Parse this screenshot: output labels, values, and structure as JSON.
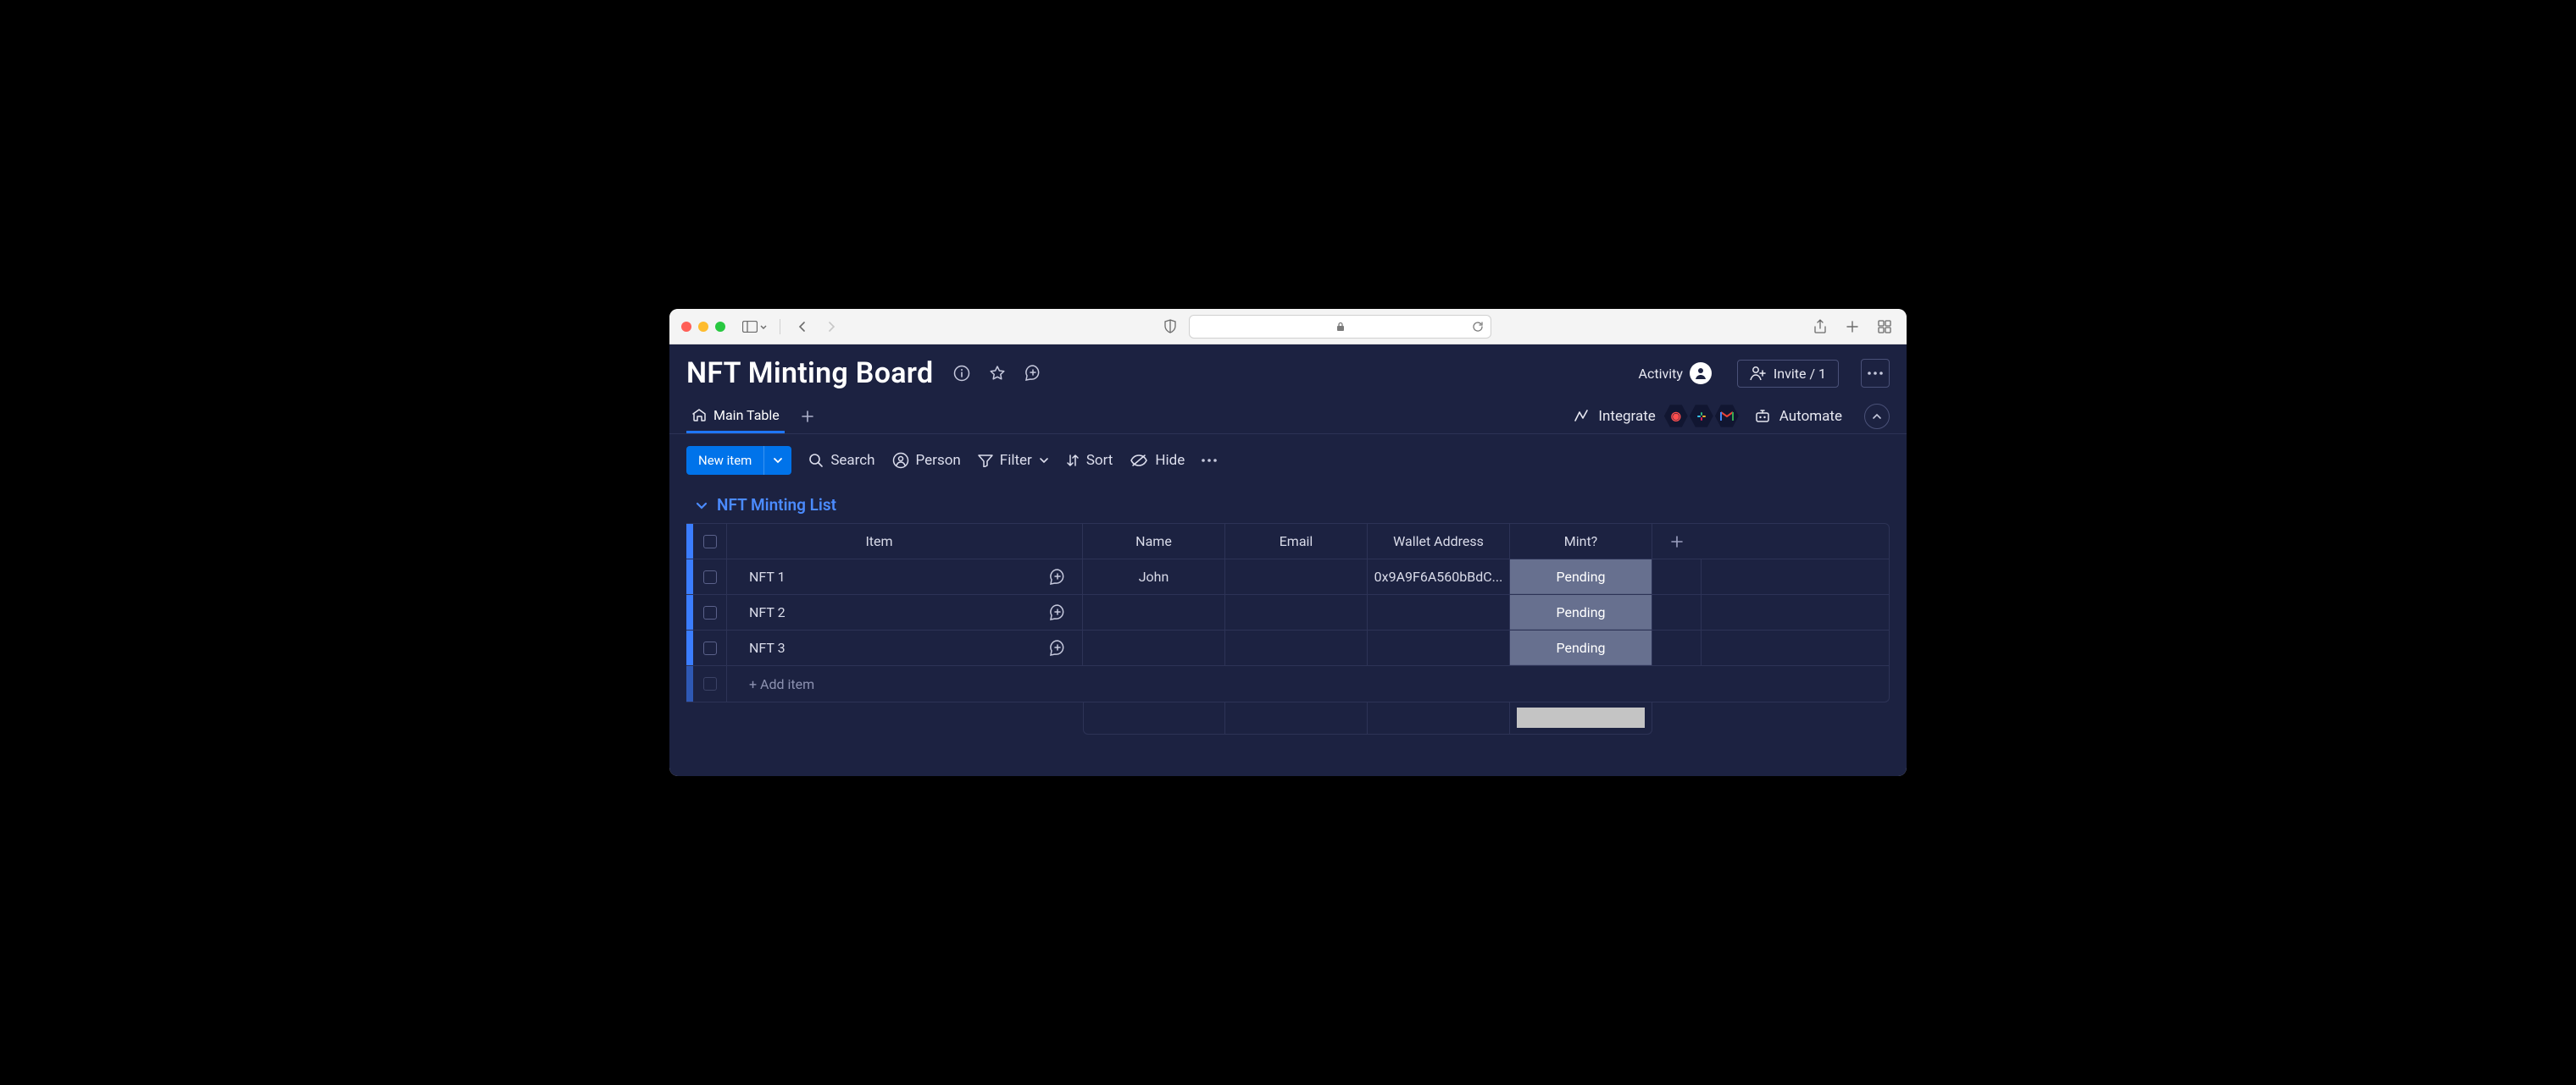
{
  "board": {
    "title": "NFT Minting Board",
    "activity_label": "Activity",
    "invite_label": "Invite / 1"
  },
  "tabs": {
    "main": "Main Table",
    "integrate": "Integrate",
    "automate": "Automate"
  },
  "toolbar": {
    "new_item": "New item",
    "search": "Search",
    "person": "Person",
    "filter": "Filter",
    "sort": "Sort",
    "hide": "Hide"
  },
  "group": {
    "title": "NFT Minting List",
    "columns": {
      "item": "Item",
      "name": "Name",
      "email": "Email",
      "wallet": "Wallet Address",
      "mint": "Mint?"
    },
    "rows": [
      {
        "item": "NFT 1",
        "name": "John",
        "email": "",
        "wallet": "0x9A9F6A560bBdC...",
        "mint": "Pending"
      },
      {
        "item": "NFT 2",
        "name": "",
        "email": "",
        "wallet": "",
        "mint": "Pending"
      },
      {
        "item": "NFT 3",
        "name": "",
        "email": "",
        "wallet": "",
        "mint": "Pending"
      }
    ],
    "add_item": "+ Add item"
  }
}
